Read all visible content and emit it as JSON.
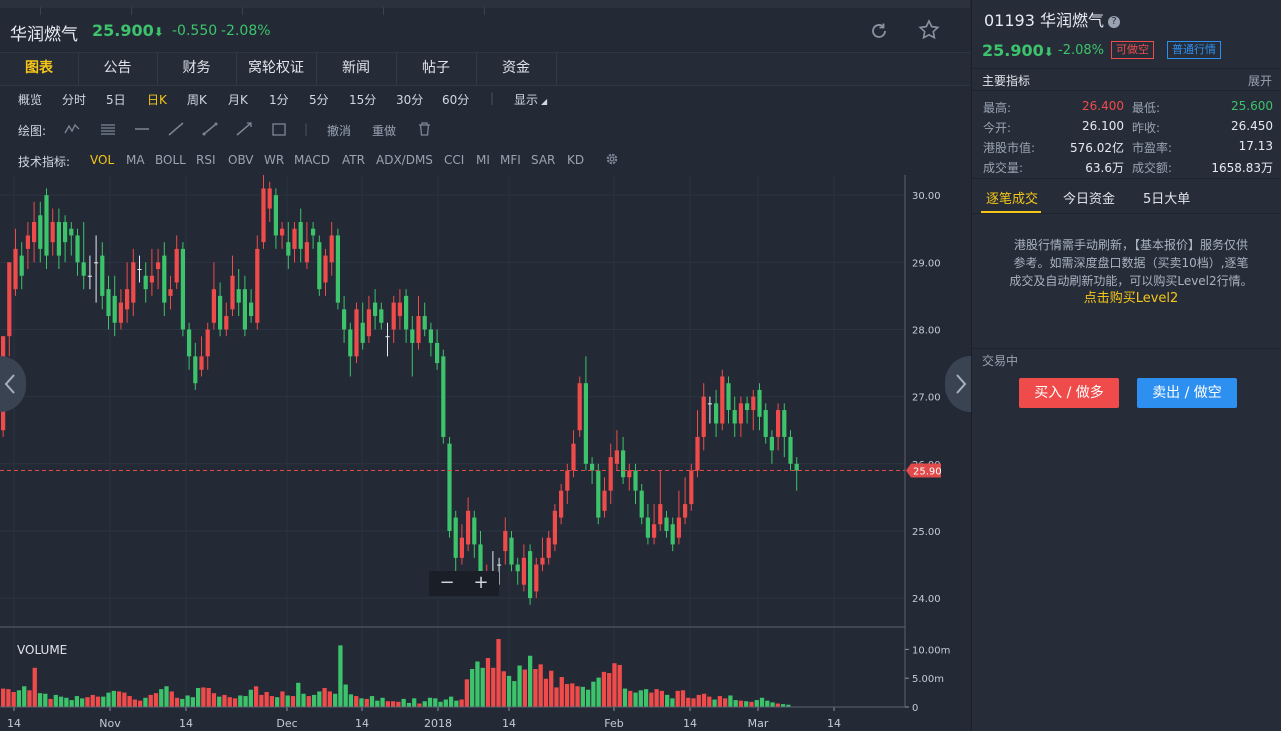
{
  "header": {
    "name": "华润燃气",
    "price": "25.900",
    "price_arrow": "⬇",
    "change": "-0.550",
    "change_pct": "-2.08%"
  },
  "tabs": [
    {
      "label": "图表",
      "active": true
    },
    {
      "label": "公告"
    },
    {
      "label": "财务"
    },
    {
      "label": "窝轮权证"
    },
    {
      "label": "新闻"
    },
    {
      "label": "帖子"
    },
    {
      "label": "资金"
    }
  ],
  "periods": [
    "概览",
    "分时",
    "5日",
    "日K",
    "周K",
    "月K",
    "1分",
    "5分",
    "15分",
    "30分",
    "60分"
  ],
  "active_period": "日K",
  "display_label": "显示",
  "drawing": {
    "label": "绘图:",
    "undo": "撤消",
    "redo": "重做"
  },
  "indicators": {
    "label": "技术指标:",
    "items": [
      "VOL",
      "MA",
      "BOLL",
      "RSI",
      "OBV",
      "WR",
      "MACD",
      "ATR",
      "ADX/DMS",
      "CCI",
      "MI",
      "MFI",
      "SAR",
      "KD"
    ],
    "active": "VOL"
  },
  "volume_label": "VOLUME",
  "chart_data": {
    "type": "candlestick",
    "price_ticks": [
      "30.00",
      "29.00",
      "28.00",
      "27.00",
      "26.00",
      "25.00",
      "24.00"
    ],
    "ylim": [
      23.6,
      30.3
    ],
    "current_price_label": "25.90",
    "current_price": 25.9,
    "volume_ticks": [
      "10.00m",
      "5.00m",
      "0"
    ],
    "volume_ylim": [
      0,
      12.5
    ],
    "x_ticks": [
      "14",
      "Nov",
      "14",
      "Dec",
      "14",
      "2018",
      "14",
      "Feb",
      "14",
      "Mar",
      "14"
    ],
    "candles": [
      [
        26.5,
        27.9,
        27.9,
        26.4
      ],
      [
        27.9,
        29.0,
        29.0,
        27.6
      ],
      [
        28.6,
        29.2,
        29.5,
        28.5
      ],
      [
        29.1,
        28.8,
        29.3,
        28.6
      ],
      [
        29.2,
        29.4,
        29.6,
        28.9
      ],
      [
        29.3,
        29.6,
        29.9,
        29.0
      ],
      [
        29.7,
        29.2,
        29.9,
        29.0
      ],
      [
        30.0,
        29.1,
        30.1,
        28.9
      ],
      [
        29.3,
        29.6,
        29.8,
        29.1
      ],
      [
        29.6,
        29.1,
        29.8,
        28.9
      ],
      [
        29.6,
        29.3,
        29.7,
        29.0
      ],
      [
        29.5,
        29.4,
        29.6,
        29.1
      ],
      [
        29.4,
        29.0,
        29.5,
        28.8
      ],
      [
        29.0,
        28.8,
        29.6,
        28.6
      ],
      [
        28.8,
        28.8,
        29.1,
        28.6
      ],
      [
        29.0,
        29.0,
        29.4,
        28.4
      ],
      [
        29.1,
        28.5,
        29.3,
        28.3
      ],
      [
        28.6,
        28.2,
        28.8,
        28.0
      ],
      [
        28.5,
        28.1,
        28.8,
        27.9
      ],
      [
        28.1,
        28.4,
        28.6,
        28.0
      ],
      [
        28.3,
        28.6,
        29.0,
        28.1
      ],
      [
        28.4,
        29.0,
        29.2,
        28.2
      ],
      [
        28.9,
        28.9,
        29.1,
        28.7
      ],
      [
        28.8,
        28.6,
        29.0,
        28.4
      ],
      [
        28.7,
        28.8,
        29.2,
        28.5
      ],
      [
        28.9,
        29.0,
        29.2,
        28.6
      ],
      [
        29.1,
        28.4,
        29.3,
        28.2
      ],
      [
        28.5,
        28.6,
        28.8,
        28.3
      ],
      [
        28.7,
        29.2,
        29.4,
        28.6
      ],
      [
        29.2,
        28.0,
        29.3,
        27.9
      ],
      [
        28.0,
        27.6,
        28.1,
        27.4
      ],
      [
        27.6,
        27.2,
        27.8,
        27.1
      ],
      [
        27.4,
        27.6,
        27.9,
        27.3
      ],
      [
        27.6,
        28.0,
        28.1,
        27.4
      ],
      [
        28.1,
        28.6,
        29.0,
        28.0
      ],
      [
        28.5,
        28.0,
        28.7,
        27.9
      ],
      [
        28.0,
        28.2,
        28.4,
        27.9
      ],
      [
        28.3,
        28.8,
        29.1,
        28.2
      ],
      [
        28.6,
        28.4,
        28.9,
        28.2
      ],
      [
        28.6,
        28.0,
        28.8,
        27.9
      ],
      [
        28.4,
        28.2,
        28.6,
        28.1
      ],
      [
        28.1,
        29.2,
        29.4,
        28.0
      ],
      [
        29.3,
        30.1,
        30.3,
        29.2
      ],
      [
        29.8,
        30.1,
        30.2,
        29.6
      ],
      [
        30.0,
        29.4,
        30.1,
        29.2
      ],
      [
        29.4,
        29.5,
        29.6,
        29.2
      ],
      [
        29.3,
        29.1,
        29.6,
        28.9
      ],
      [
        29.2,
        29.5,
        29.6,
        29.0
      ],
      [
        29.6,
        29.2,
        29.8,
        29.0
      ],
      [
        29.0,
        29.3,
        29.6,
        28.9
      ],
      [
        29.5,
        29.4,
        29.6,
        29.2
      ],
      [
        29.3,
        28.6,
        29.4,
        28.5
      ],
      [
        28.7,
        29.1,
        29.2,
        28.5
      ],
      [
        29.0,
        29.4,
        29.6,
        28.8
      ],
      [
        29.4,
        28.4,
        29.5,
        28.3
      ],
      [
        28.3,
        28.0,
        28.5,
        27.8
      ],
      [
        28.0,
        27.6,
        28.1,
        27.3
      ],
      [
        27.6,
        28.3,
        28.4,
        27.5
      ],
      [
        28.1,
        27.8,
        28.4,
        27.7
      ],
      [
        27.9,
        28.3,
        28.5,
        27.8
      ],
      [
        28.4,
        28.2,
        28.6,
        28.0
      ],
      [
        28.3,
        28.1,
        28.4,
        28.0
      ],
      [
        27.9,
        27.9,
        28.1,
        27.6
      ],
      [
        28.0,
        28.4,
        28.5,
        27.8
      ],
      [
        28.2,
        28.4,
        28.6,
        28.0
      ],
      [
        28.5,
        28.0,
        28.6,
        27.8
      ],
      [
        28.0,
        27.8,
        28.2,
        27.3
      ],
      [
        27.8,
        28.2,
        28.5,
        27.7
      ],
      [
        28.2,
        28.0,
        28.4,
        27.9
      ],
      [
        28.0,
        27.8,
        28.1,
        27.6
      ],
      [
        27.8,
        27.5,
        28.0,
        27.4
      ],
      [
        27.6,
        26.4,
        27.7,
        26.3
      ],
      [
        26.3,
        25.0,
        26.4,
        24.9
      ],
      [
        25.2,
        24.6,
        25.3,
        24.4
      ],
      [
        24.6,
        24.9,
        25.1,
        24.5
      ],
      [
        24.8,
        25.3,
        25.5,
        24.7
      ],
      [
        25.2,
        24.8,
        25.3,
        24.6
      ],
      [
        24.8,
        24.3,
        25.0,
        24.2
      ],
      [
        24.2,
        24.4,
        24.5,
        24.1
      ],
      [
        24.4,
        24.4,
        24.7,
        24.2
      ],
      [
        24.5,
        24.5,
        24.6,
        24.2
      ],
      [
        24.7,
        25.0,
        25.2,
        24.5
      ],
      [
        24.9,
        24.5,
        25.0,
        24.4
      ],
      [
        24.5,
        24.4,
        24.6,
        24.2
      ],
      [
        24.2,
        24.6,
        24.8,
        24.1
      ],
      [
        24.7,
        24.0,
        24.8,
        23.9
      ],
      [
        24.1,
        24.5,
        24.6,
        24.0
      ],
      [
        24.5,
        24.6,
        24.9,
        24.4
      ],
      [
        24.6,
        24.9,
        25.0,
        24.5
      ],
      [
        24.8,
        25.3,
        25.4,
        24.7
      ],
      [
        25.2,
        25.6,
        25.7,
        25.1
      ],
      [
        25.6,
        25.9,
        26.0,
        25.4
      ],
      [
        25.9,
        26.3,
        26.5,
        25.8
      ],
      [
        26.5,
        27.2,
        27.3,
        26.4
      ],
      [
        27.2,
        26.0,
        27.6,
        25.9
      ],
      [
        26.0,
        25.9,
        26.1,
        25.7
      ],
      [
        25.9,
        25.2,
        26.0,
        25.1
      ],
      [
        25.3,
        25.6,
        25.8,
        25.2
      ],
      [
        25.6,
        26.1,
        26.3,
        25.4
      ],
      [
        26.0,
        26.2,
        26.5,
        25.9
      ],
      [
        26.2,
        25.8,
        26.4,
        25.7
      ],
      [
        25.8,
        25.9,
        26.0,
        25.6
      ],
      [
        25.9,
        25.6,
        26.0,
        25.4
      ],
      [
        25.6,
        25.2,
        25.7,
        25.1
      ],
      [
        25.2,
        24.9,
        25.4,
        24.8
      ],
      [
        24.9,
        25.1,
        25.4,
        24.8
      ],
      [
        25.1,
        25.4,
        25.9,
        25.0
      ],
      [
        25.2,
        25.0,
        25.3,
        24.9
      ],
      [
        25.1,
        24.8,
        25.2,
        24.7
      ],
      [
        24.9,
        25.2,
        25.6,
        24.8
      ],
      [
        25.2,
        25.4,
        25.8,
        25.1
      ],
      [
        25.4,
        25.9,
        26.0,
        25.3
      ],
      [
        25.9,
        26.4,
        26.8,
        25.8
      ],
      [
        26.4,
        27.0,
        27.2,
        26.2
      ],
      [
        26.9,
        26.9,
        27.0,
        26.6
      ],
      [
        26.9,
        26.6,
        27.1,
        26.4
      ],
      [
        26.6,
        27.3,
        27.4,
        26.5
      ],
      [
        27.2,
        26.8,
        27.3,
        26.6
      ],
      [
        26.8,
        26.6,
        27.0,
        26.4
      ],
      [
        26.6,
        26.9,
        27.0,
        26.4
      ],
      [
        26.9,
        26.8,
        27.0,
        26.6
      ],
      [
        26.8,
        27.0,
        27.1,
        26.5
      ],
      [
        27.1,
        26.7,
        27.2,
        26.5
      ],
      [
        26.8,
        26.4,
        26.9,
        26.3
      ],
      [
        26.4,
        26.2,
        26.5,
        26.0
      ],
      [
        26.4,
        26.8,
        26.9,
        26.2
      ],
      [
        26.8,
        26.4,
        26.9,
        26.1
      ],
      [
        26.4,
        26.0,
        26.5,
        25.9
      ],
      [
        26.0,
        25.9,
        26.1,
        25.6
      ]
    ],
    "volumes": [
      3.2,
      3.1,
      2.6,
      2.9,
      3.6,
      2.9,
      6.8,
      2.4,
      2.3,
      1.4,
      2.1,
      1.8,
      1.6,
      1.2,
      1.9,
      1.5,
      1.7,
      2.1,
      1.8,
      1.8,
      2.5,
      2.8,
      2.7,
      2.5,
      1.9,
      1.3,
      1.1,
      1.6,
      2.1,
      2.4,
      3.1,
      3.6,
      2.7,
      1.6,
      1.4,
      2.0,
      1.7,
      3.3,
      3.4,
      3.3,
      2.4,
      1.8,
      2.1,
      1.7,
      1.5,
      2.0,
      1.9,
      3.0,
      3.6,
      2.1,
      2.6,
      1.9,
      1.7,
      2.7,
      2.0,
      1.9,
      4.2,
      2.3,
      1.9,
      2.1,
      2.7,
      3.3,
      2.7,
      2.3,
      10.7,
      3.9,
      2.2,
      1.9,
      1.5,
      1.4,
      1.9,
      1.1,
      1.6,
      1.0,
      1.0,
      0.9,
      1.4,
      0.7,
      1.5,
      0.6,
      1.0,
      1.6,
      1.5,
      0.9,
      1.3,
      1.8,
      1.1,
      1.3,
      4.8,
      6.6,
      7.9,
      6.8,
      8.5,
      6.8,
      11.8,
      6.2,
      5.4,
      4.5,
      7.2,
      6.5,
      8.9,
      6.6,
      7.4,
      4.9,
      6.3,
      3.4,
      5.2,
      4.0,
      4.1,
      3.6,
      3.5,
      3.0,
      4.4,
      5.1,
      6.1,
      5.9,
      7.6,
      7.3,
      3.2,
      2.8,
      2.5,
      2.9,
      3.1,
      2.5,
      3.1,
      2.8,
      2.1,
      1.5,
      2.8,
      2.9,
      1.6,
      1.5,
      2.1,
      2.3,
      1.8,
      1.3,
      1.9,
      1.5,
      2.0,
      1.2,
      1.1,
      1.0,
      0.9,
      1.2,
      1.6,
      1.1,
      0.8,
      0.6,
      0.5,
      0.4
    ]
  },
  "sidebar": {
    "code_name": "01193 华润燃气",
    "price": "25.900",
    "price_arrow": "⬇",
    "change_pct": "-2.08%",
    "badge_short": "可做空",
    "badge_connect": "普通行情",
    "metrics_title": "主要指标",
    "expand": "展开",
    "metrics": [
      {
        "k": "最高:",
        "v": "26.400",
        "k2": "最低:",
        "v2": "25.600"
      },
      {
        "k": "今开:",
        "v": "26.100",
        "k2": "昨收:",
        "v2": "26.450"
      },
      {
        "k": "港股市值:",
        "v": "576.02亿",
        "k2": "市盈率:",
        "v2": "17.13"
      },
      {
        "k": "成交量:",
        "v": "63.6万",
        "k2": "成交额:",
        "v2": "1658.83万"
      }
    ],
    "tabs": [
      "逐笔成交",
      "今日资金",
      "5日大单"
    ],
    "notice_line1": "港股行情需手动刷新，【基本报价】服务仅供",
    "notice_line2": "参考。如需深度盘口数据（买卖10档）,逐笔",
    "notice_line3": "成交及自动刷新功能，可以购买Level2行情。",
    "notice_link": "点击购买Level2",
    "trading_status": "交易中",
    "buy_label": "买入 / 做多",
    "sell_label": "卖出 / 做空"
  },
  "colors": {
    "up": "#f04b4b",
    "down": "#3dc36b",
    "accent": "#f5c518",
    "bg": "#232a36"
  }
}
